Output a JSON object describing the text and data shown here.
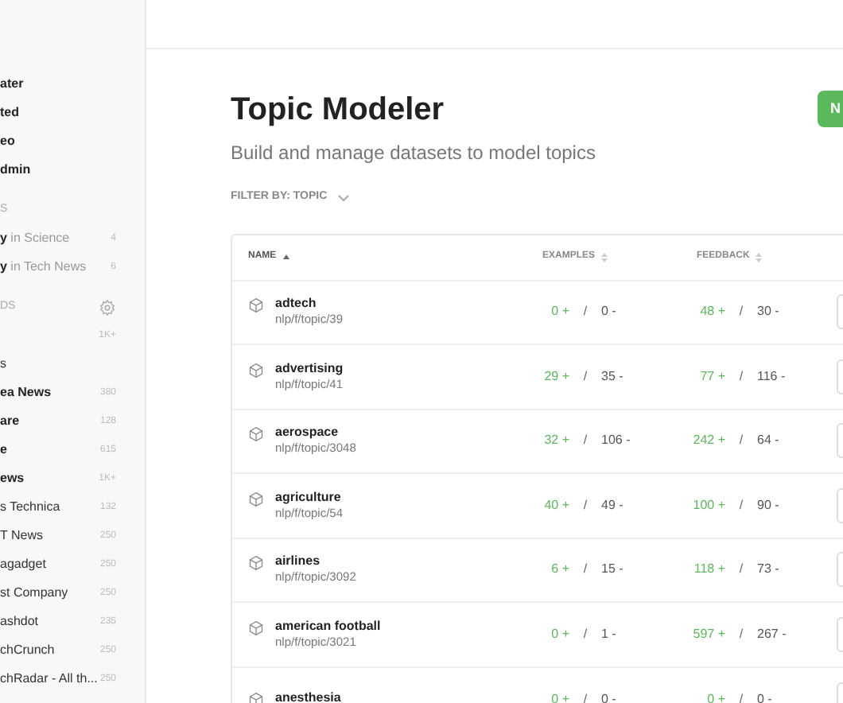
{
  "sidebar": {
    "nav": [
      {
        "label": "ater"
      },
      {
        "label": "ted"
      },
      {
        "label": "eo"
      },
      {
        "label": "dmin"
      }
    ],
    "shortcuts_heading": "S",
    "shortcuts": [
      {
        "bold": "y",
        "rest": " in Science",
        "count": "4"
      },
      {
        "bold": "y",
        "rest": " in Tech News",
        "count": "6"
      }
    ],
    "feeds_heading": "DS",
    "feeds": [
      {
        "count": "1K+"
      },
      {
        "label": "s",
        "bold": false
      },
      {
        "label": "ea News",
        "count": "380",
        "bold": true
      },
      {
        "label": "are",
        "count": "128",
        "bold": true
      },
      {
        "label": "e",
        "count": "615",
        "bold": true
      },
      {
        "label": "ews",
        "count": "1K+",
        "bold": true
      },
      {
        "label": "s Technica",
        "count": "132",
        "bold": false
      },
      {
        "label": "T News",
        "count": "250",
        "bold": false
      },
      {
        "label": "agadget",
        "count": "250",
        "bold": false
      },
      {
        "label": "st Company",
        "count": "250",
        "bold": false
      },
      {
        "label": "ashdot",
        "count": "235",
        "bold": false
      },
      {
        "label": "chCrunch",
        "count": "250",
        "bold": false
      },
      {
        "label": "chRadar - All th...",
        "count": "250",
        "bold": false
      }
    ]
  },
  "page": {
    "title": "Topic Modeler",
    "subtitle": "Build and manage datasets to model topics",
    "new_button": "N",
    "filter": "FILTER BY: TOPIC"
  },
  "table": {
    "columns": [
      {
        "label": "NAME",
        "sorted": true
      },
      {
        "label": "EXAMPLES",
        "sorted": false
      },
      {
        "label": "FEEDBACK",
        "sorted": false
      }
    ],
    "rows": [
      {
        "name": "adtech",
        "path": "nlp/f/topic/39",
        "examples_pos": "0 +",
        "examples_neg": "0 -",
        "feedback_pos": "48 +",
        "feedback_neg": "30 -"
      },
      {
        "name": "advertising",
        "path": "nlp/f/topic/41",
        "examples_pos": "29 +",
        "examples_neg": "35 -",
        "feedback_pos": "77 +",
        "feedback_neg": "116 -"
      },
      {
        "name": "aerospace",
        "path": "nlp/f/topic/3048",
        "examples_pos": "32 +",
        "examples_neg": "106 -",
        "feedback_pos": "242 +",
        "feedback_neg": "64 -"
      },
      {
        "name": "agriculture",
        "path": "nlp/f/topic/54",
        "examples_pos": "40 +",
        "examples_neg": "49 -",
        "feedback_pos": "100 +",
        "feedback_neg": "90 -"
      },
      {
        "name": "airlines",
        "path": "nlp/f/topic/3092",
        "examples_pos": "6 +",
        "examples_neg": "15 -",
        "feedback_pos": "118 +",
        "feedback_neg": "73 -"
      },
      {
        "name": "american football",
        "path": "nlp/f/topic/3021",
        "examples_pos": "0 +",
        "examples_neg": "1 -",
        "feedback_pos": "597 +",
        "feedback_neg": "267 -"
      },
      {
        "name": "anesthesia",
        "examples_pos": "0 +",
        "examples_neg": "0 -",
        "feedback_pos": "0 +",
        "feedback_neg": "0 -"
      }
    ],
    "separator": "/"
  }
}
